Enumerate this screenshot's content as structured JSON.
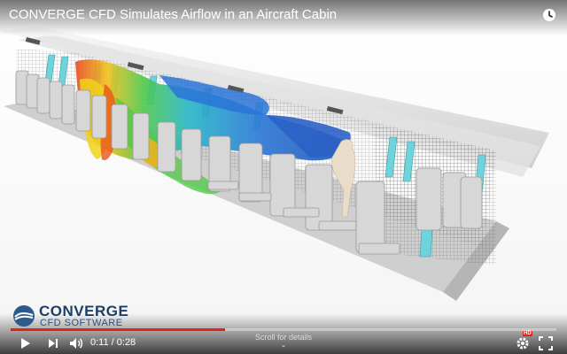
{
  "video": {
    "title": "CONVERGE CFD Simulates Airflow in an Aircraft Cabin",
    "logo": {
      "line1": "CONVERGE",
      "line2": "CFD SOFTWARE"
    }
  },
  "controls": {
    "time_current": "0:11",
    "time_separator": " / ",
    "time_total": "0:28",
    "progress_fraction": 0.393,
    "scroll_hint": "Scroll for details",
    "hd_badge": "HD"
  },
  "icons": {
    "play": "play-icon",
    "next": "next-icon",
    "volume": "volume-icon",
    "settings": "gear-icon",
    "fullscreen": "fullscreen-icon",
    "watch_later": "clock-icon"
  },
  "colors": {
    "progress": "#e62117",
    "logo": "#1f3e66"
  }
}
